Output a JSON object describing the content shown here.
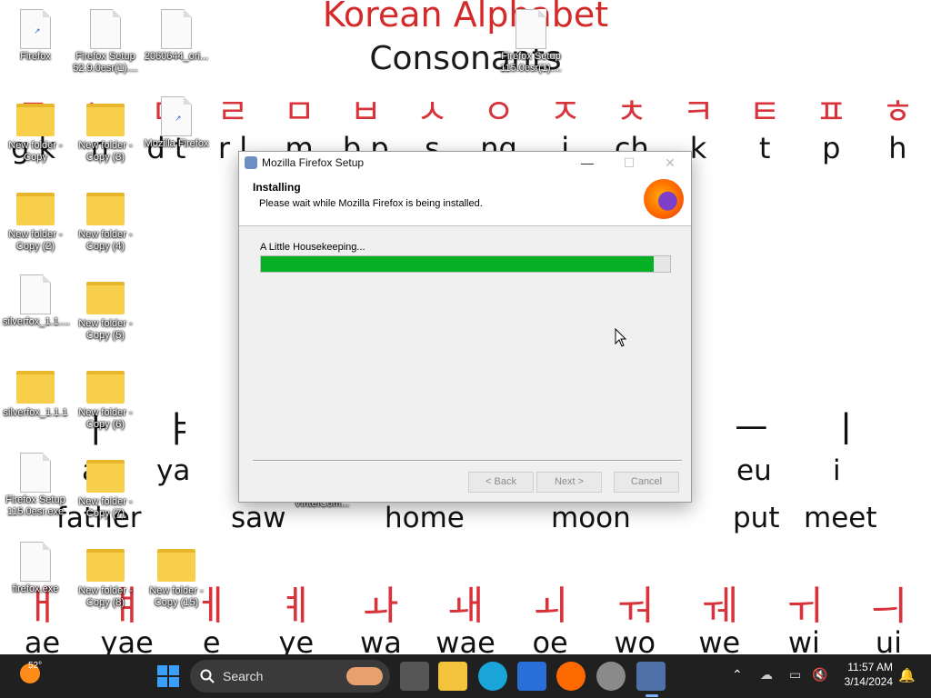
{
  "wallpaper": {
    "title": "Korean Alphabet",
    "subtitle": "Consonants",
    "consonants_hangul": [
      "ㄱ",
      "ㄴ",
      "ㄷ",
      "ㄹ",
      "ㅁ",
      "ㅂ",
      "ㅅ",
      "ㅇ",
      "ㅈ",
      "ㅊ",
      "ㅋ",
      "ㅌ",
      "ㅍ",
      "ㅎ"
    ],
    "consonants_roman": [
      "g k",
      "n",
      "d t",
      "r l",
      "m",
      "b p",
      "s",
      "ng",
      "j",
      "ch",
      "k",
      "t",
      "p",
      "h"
    ],
    "vowels_hangul_partial": [
      "ㅏ",
      "ㅑ",
      "ㅡ",
      "ㅣ"
    ],
    "vowels_roman_partial": [
      "a",
      "ya",
      "eu",
      "i"
    ],
    "examples": [
      "father",
      "saw",
      "home",
      "moon",
      "put",
      "meet"
    ],
    "compound_hangul": [
      "ㅐ",
      "ㅒ",
      "ㅔ",
      "ㅖ",
      "ㅘ",
      "ㅙ",
      "ㅚ",
      "ㅝ",
      "ㅞ",
      "ㅟ",
      "ㅢ"
    ],
    "compound_roman": [
      "ae",
      "yae",
      "e",
      "ye",
      "wa",
      "wae",
      "oe",
      "wo",
      "we",
      "wi",
      "ui"
    ]
  },
  "desktop_icons": [
    {
      "label": "Firefox",
      "kind": "file"
    },
    {
      "label": "Firefox Setup 52.9.0esr(1)....",
      "kind": "file"
    },
    {
      "label": "2060644_ori...",
      "kind": "file"
    },
    {
      "label": "Firefox Setup 115.0esr(1)....",
      "kind": "file"
    },
    {
      "label": "New folder - Copy",
      "kind": "folder"
    },
    {
      "label": "New folder - Copy (3)",
      "kind": "folder"
    },
    {
      "label": "Mozilla Firefox",
      "kind": "file"
    },
    {
      "label": "New folder - Copy (2)",
      "kind": "folder"
    },
    {
      "label": "New folder - Copy (4)",
      "kind": "folder"
    },
    {
      "label": "silverfox_1.1....",
      "kind": "file"
    },
    {
      "label": "New folder - Copy (5)",
      "kind": "folder"
    },
    {
      "label": "silverfox_1.1.1",
      "kind": "folder"
    },
    {
      "label": "New folder - Copy (6)",
      "kind": "folder"
    },
    {
      "label": "Firefox Setup 115.0esr.exe",
      "kind": "file"
    },
    {
      "label": "New folder - Copy (7)",
      "kind": "folder"
    },
    {
      "label": "firefox.exe",
      "kind": "file"
    },
    {
      "label": "New folder - Copy (8)",
      "kind": "folder"
    },
    {
      "label": "New folder - Copy (15)",
      "kind": "folder"
    }
  ],
  "overlay_label": "VinteICom...",
  "dialog": {
    "title": "Mozilla Firefox Setup",
    "minimize": "—",
    "maximize": "☐",
    "close": "✕",
    "heading": "Installing",
    "subheading": "Please wait while Mozilla Firefox is being installed.",
    "status": "A Little Housekeeping...",
    "progress_percent": 96,
    "back_label": "< Back",
    "next_label": "Next >",
    "cancel_label": "Cancel"
  },
  "taskbar": {
    "weather_temp": "52°",
    "search_label": "Search",
    "time": "11:57 AM",
    "date": "3/14/2024"
  },
  "colors": {
    "progress": "#06b025",
    "taskbar": "#202020",
    "hangul": "#d8323a"
  }
}
